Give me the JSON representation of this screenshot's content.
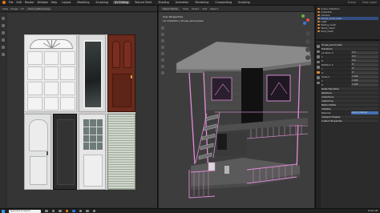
{
  "menu": {
    "app_icon": "blender-logo",
    "items": [
      "File",
      "Edit",
      "Render",
      "Window",
      "Help"
    ],
    "tabs": [
      "Layout",
      "Modeling",
      "Sculpting",
      "UV Editing",
      "Texture Paint",
      "Shading",
      "Animation",
      "Rendering",
      "Compositing",
      "Scripting"
    ],
    "active_tab": "UV Editing",
    "scene": "Scene",
    "view_layer": "View Layer"
  },
  "image_editor": {
    "header": [
      "View",
      "Image",
      "UV",
      "doors_texture.png"
    ],
    "texture_name": "doors_texture.png"
  },
  "viewport": {
    "header": [
      "Object Mode",
      "View",
      "Select",
      "Add",
      "Object"
    ],
    "info_line1": "User Perspective",
    "info_line2": "(1) Collection | House_wood_base"
  },
  "outliner": {
    "rows": [
      {
        "label": "Scene Collection",
        "selected": false
      },
      {
        "label": "Collection",
        "selected": false
      },
      {
        "label": "Camera",
        "selected": false
      },
      {
        "label": "House_wood_base",
        "selected": true
      },
      {
        "label": "Light",
        "selected": false
      },
      {
        "label": "Railing_mesh",
        "selected": false
      },
      {
        "label": "Stairs_mesh",
        "selected": false
      },
      {
        "label": "Roof_mesh",
        "selected": false
      }
    ]
  },
  "properties": {
    "rows": [
      {
        "label": "House_wood_base",
        "value": "",
        "section": true
      },
      {
        "label": "Transform",
        "value": "",
        "section": true
      },
      {
        "label": "Location X",
        "value": "0 m"
      },
      {
        "label": "Y",
        "value": "0 m"
      },
      {
        "label": "Z",
        "value": "0 m"
      },
      {
        "label": "Rotation X",
        "value": "0°"
      },
      {
        "label": "Y",
        "value": "0°"
      },
      {
        "label": "Z",
        "value": "0°"
      },
      {
        "label": "Scale X",
        "value": "1.000"
      },
      {
        "label": "Y",
        "value": "1.000"
      },
      {
        "label": "Z",
        "value": "1.000"
      },
      {
        "label": "Delta Transform",
        "value": "",
        "section": true
      },
      {
        "label": "Relations",
        "value": "",
        "section": true
      },
      {
        "label": "Collections",
        "value": "",
        "section": true
      },
      {
        "label": "Instancing",
        "value": "",
        "section": true
      },
      {
        "label": "Motion Paths",
        "value": "",
        "section": true
      },
      {
        "label": "Visibility",
        "value": "",
        "section": true
      },
      {
        "label": "Material",
        "value": "wood_material",
        "highlight": true
      },
      {
        "label": "Viewport Display",
        "value": "",
        "section": true
      },
      {
        "label": "Custom Properties",
        "value": "",
        "section": true
      }
    ]
  },
  "taskbar": {
    "search_placeholder": "Type here to search",
    "time": "10:42 AM"
  },
  "colors": {
    "accent": "#4772b3",
    "selection": "#334d80",
    "edge_highlight": "#e38ad8"
  }
}
